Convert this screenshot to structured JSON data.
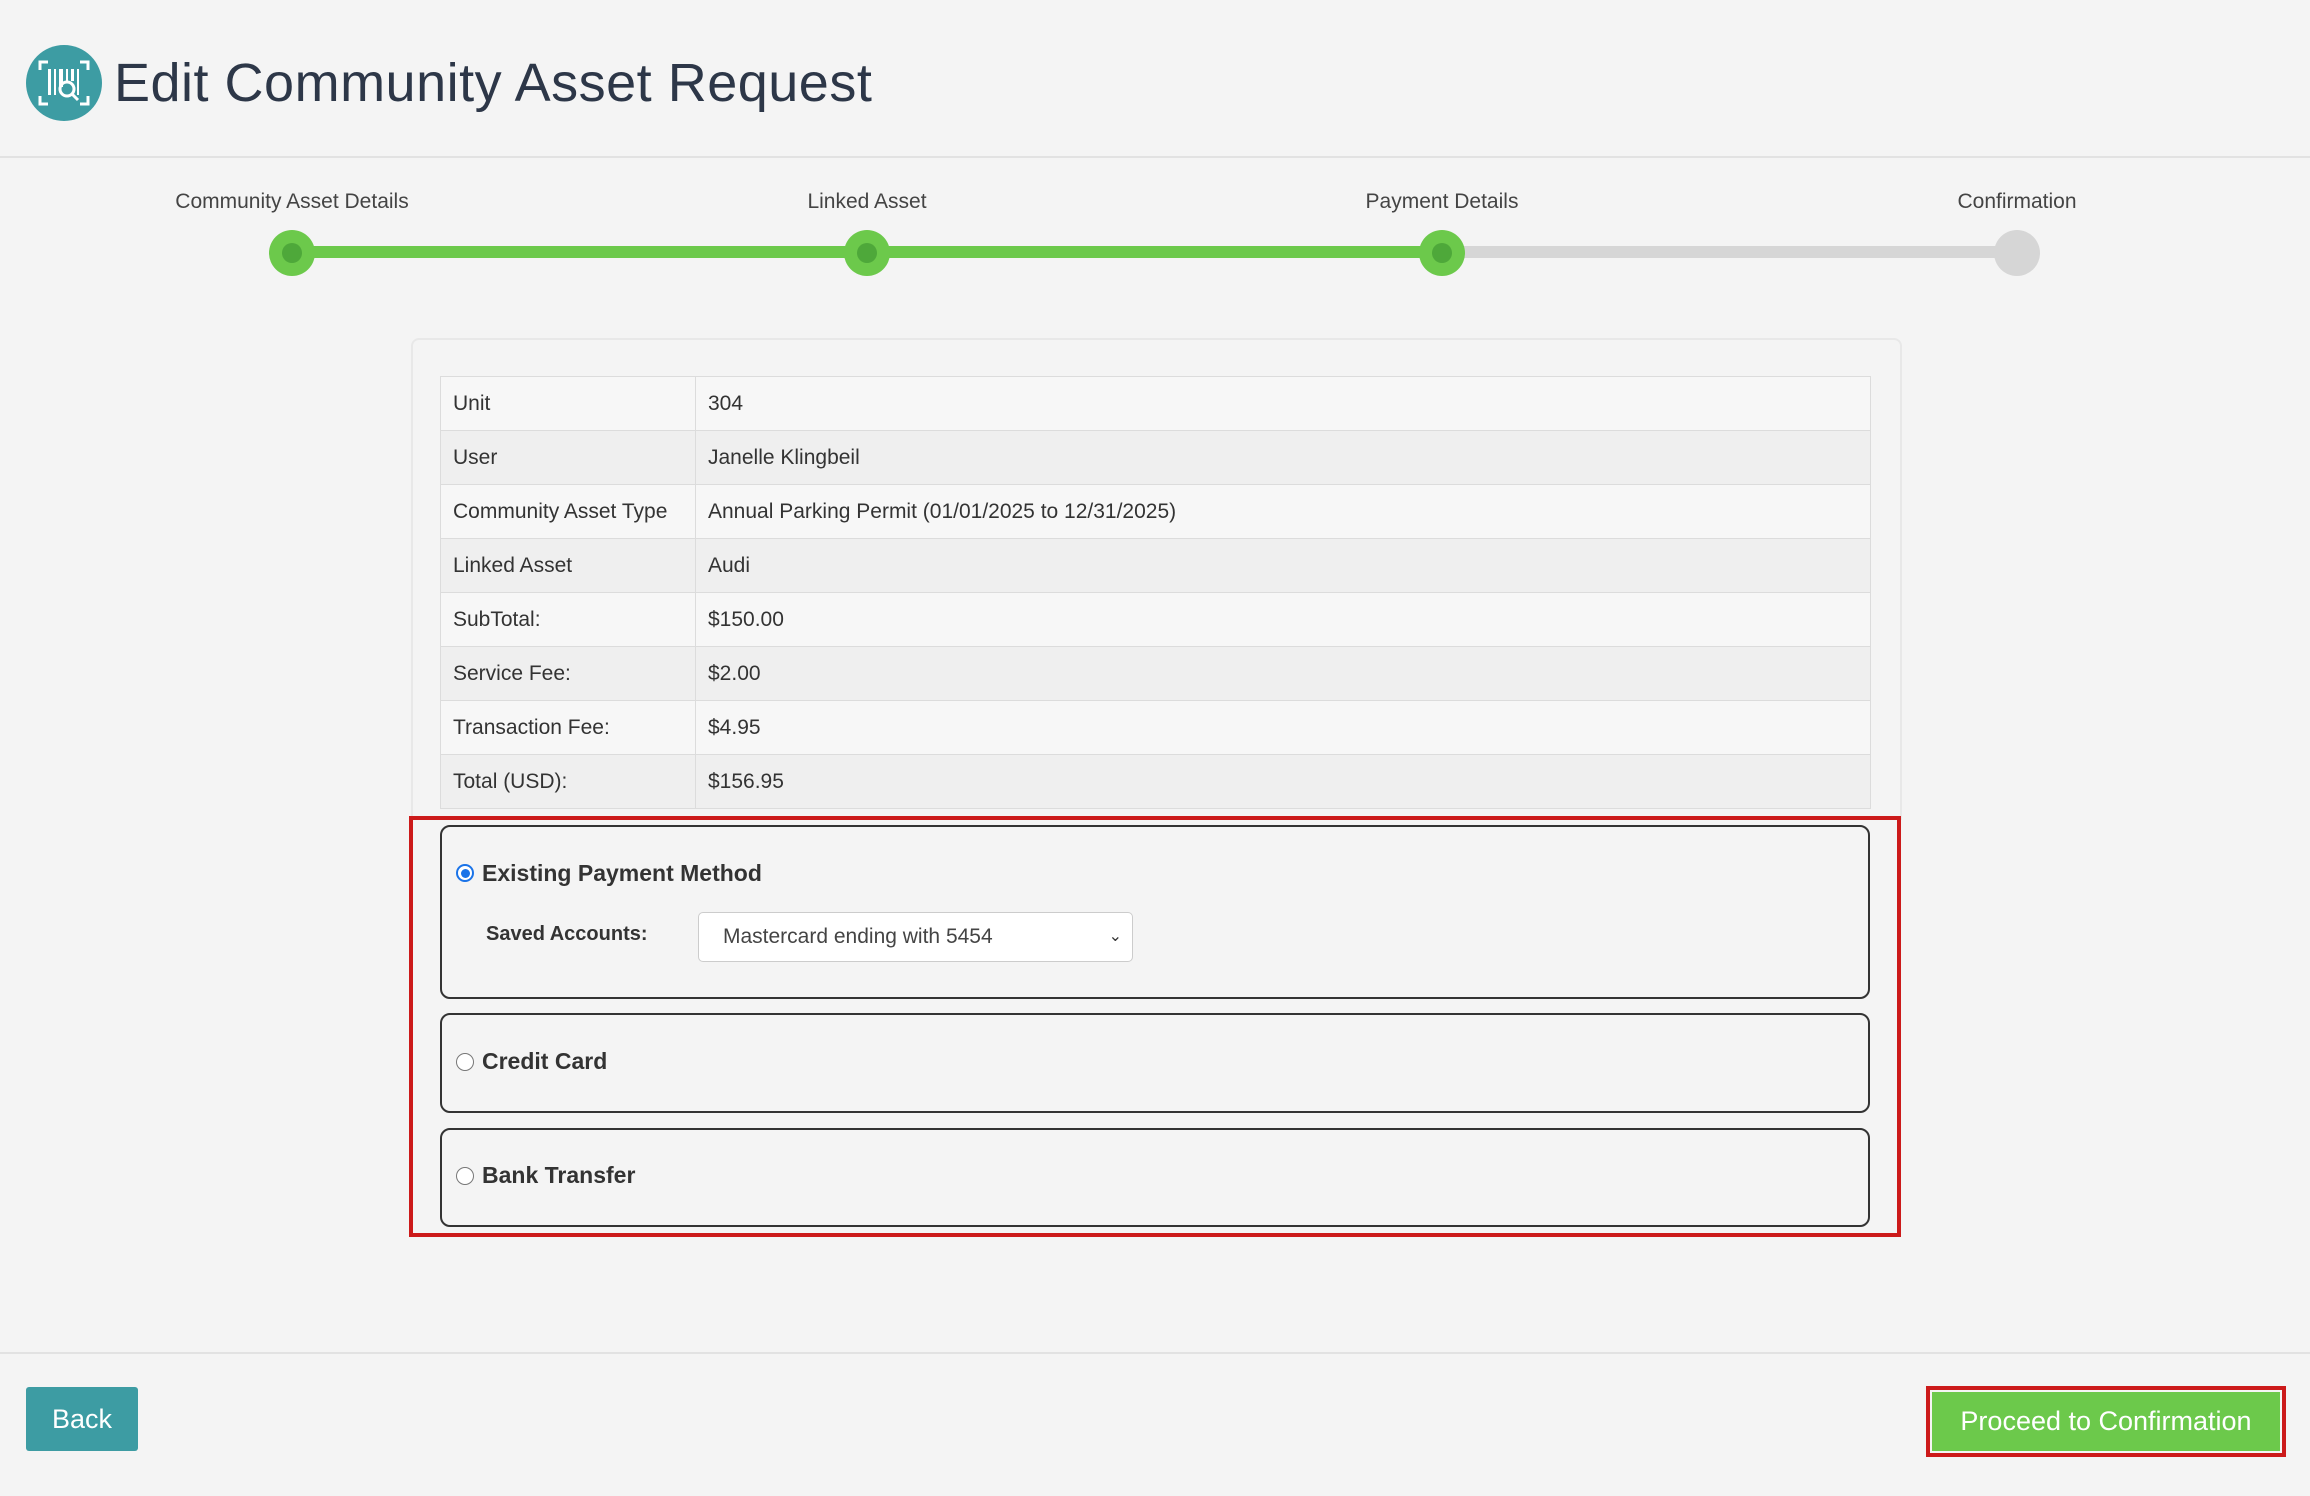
{
  "header": {
    "title": "Edit Community Asset Request",
    "logo_icon": "barcode-scan-icon"
  },
  "stepper": {
    "steps": [
      {
        "label": "Community Asset Details",
        "state": "complete"
      },
      {
        "label": "Linked Asset",
        "state": "complete"
      },
      {
        "label": "Payment Details",
        "state": "current"
      },
      {
        "label": "Confirmation",
        "state": "pending"
      }
    ],
    "active_color": "#6cc94b",
    "inactive_color": "#d6d6d6"
  },
  "summary": {
    "rows": [
      {
        "key": "Unit",
        "value": "304"
      },
      {
        "key": "User",
        "value": "Janelle Klingbeil"
      },
      {
        "key": "Community Asset Type",
        "value": "Annual Parking Permit (01/01/2025 to 12/31/2025)"
      },
      {
        "key": "Linked Asset",
        "value": "Audi"
      },
      {
        "key": "SubTotal:",
        "value": "$150.00"
      },
      {
        "key": "Service Fee:",
        "value": "$2.00"
      },
      {
        "key": "Transaction Fee:",
        "value": "$4.95"
      },
      {
        "key": "Total (USD):",
        "value": "$156.95"
      }
    ]
  },
  "payment": {
    "methods": [
      {
        "label": "Existing Payment Method",
        "selected": true
      },
      {
        "label": "Credit Card",
        "selected": false
      },
      {
        "label": "Bank Transfer",
        "selected": false
      }
    ],
    "saved_accounts_label": "Saved Accounts:",
    "saved_accounts_value": "Mastercard ending with 5454"
  },
  "footer": {
    "back_label": "Back",
    "proceed_label": "Proceed to Confirmation"
  },
  "colors": {
    "teal": "#3d9ca3",
    "green": "#6cc94b",
    "highlight_red": "#cc1a1a"
  }
}
